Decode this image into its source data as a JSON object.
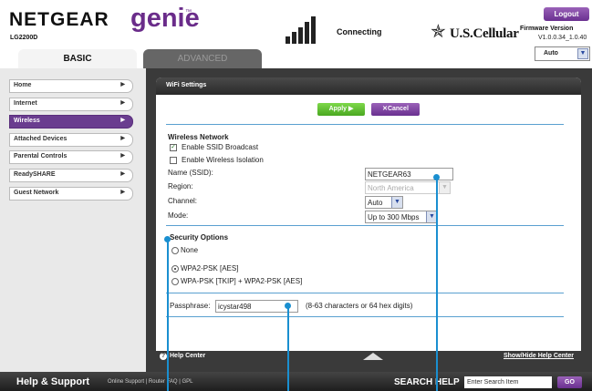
{
  "header": {
    "brand": "NETGEAR",
    "product": "genie",
    "trademark": "™",
    "model": "LG2200D",
    "connection_status": "Connecting",
    "carrier": "U.S.Cellular",
    "logout_label": "Logout",
    "firmware_label": "Firmware Version",
    "firmware_version": "V1.0.0.34_1.0.40",
    "language_value": "Auto"
  },
  "tabs": [
    {
      "label": "BASIC",
      "active": true
    },
    {
      "label": "ADVANCED",
      "active": false
    }
  ],
  "sidebar": {
    "items": [
      {
        "label": "Home",
        "active": false
      },
      {
        "label": "Internet",
        "active": false
      },
      {
        "label": "Wireless",
        "active": true
      },
      {
        "label": "Attached Devices",
        "active": false
      },
      {
        "label": "Parental Controls",
        "active": false
      },
      {
        "label": "ReadySHARE",
        "active": false
      },
      {
        "label": "Guest Network",
        "active": false
      }
    ]
  },
  "panel": {
    "title": "WiFi Settings",
    "apply_label": "Apply ▶",
    "cancel_label": "✕Cancel"
  },
  "wireless_network": {
    "heading": "Wireless Network",
    "ssid_broadcast_label": "Enable SSID Broadcast",
    "ssid_broadcast_checked": true,
    "isolation_label": "Enable Wireless Isolation",
    "isolation_checked": false,
    "ssid_label": "Name (SSID):",
    "ssid_value": "NETGEAR63",
    "region_label": "Region:",
    "region_value": "North America",
    "channel_label": "Channel:",
    "channel_value": "Auto",
    "mode_label": "Mode:",
    "mode_value": "Up to 300 Mbps"
  },
  "security": {
    "heading": "Security Options",
    "options": [
      {
        "label": "None",
        "selected": false
      },
      {
        "label": "WPA2-PSK [AES]",
        "selected": true
      },
      {
        "label": "WPA-PSK [TKIP] + WPA2-PSK [AES]",
        "selected": false
      }
    ],
    "passphrase_label": "Passphrase:",
    "passphrase_value": "icystar498",
    "passphrase_hint": "(8-63 characters or 64 hex digits)"
  },
  "help_center": {
    "label": "Help Center",
    "toggle_label": "Show/Hide Help Center"
  },
  "footer": {
    "title": "Help & Support",
    "links": "Online Support | Router FAQ | GPL",
    "search_label": "SEARCH HELP",
    "search_placeholder": "Enter Search Item",
    "go_label": "GO"
  },
  "colors": {
    "brand_purple": "#6a2c8a",
    "apply_green": "#4aa820",
    "callout_blue": "#1a8fd0",
    "dark_band": "#3a3a3a"
  }
}
